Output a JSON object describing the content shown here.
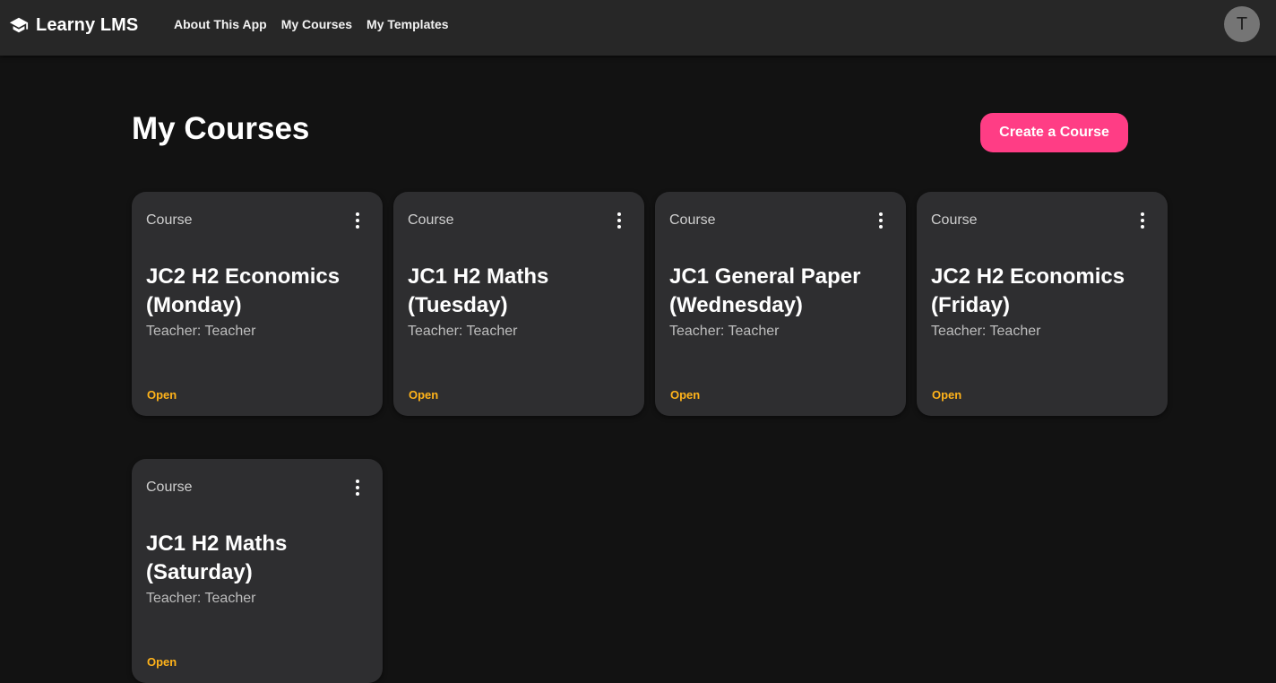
{
  "app": {
    "title": "Learny LMS",
    "icon": "graduation-cap-icon"
  },
  "nav": {
    "items": [
      {
        "label": "About This App"
      },
      {
        "label": "My Courses"
      },
      {
        "label": "My Templates"
      }
    ]
  },
  "user": {
    "avatar_initial": "T"
  },
  "main": {
    "title": "My Courses",
    "create_button": "Create a Course"
  },
  "courses": [
    {
      "kind": "Course",
      "title": "JC2 H2 Economics (Monday)",
      "teacher": "Teacher: Teacher",
      "action": "Open"
    },
    {
      "kind": "Course",
      "title": "JC1 H2 Maths (Tuesday)",
      "teacher": "Teacher: Teacher",
      "action": "Open"
    },
    {
      "kind": "Course",
      "title": "JC1 General Paper (Wednesday)",
      "teacher": "Teacher: Teacher",
      "action": "Open"
    },
    {
      "kind": "Course",
      "title": "JC2 H2 Economics (Friday)",
      "teacher": "Teacher: Teacher",
      "action": "Open"
    },
    {
      "kind": "Course",
      "title": "JC1 H2 Maths (Saturday)",
      "teacher": "Teacher: Teacher",
      "action": "Open"
    }
  ],
  "colors": {
    "background": "#121212",
    "topbar": "#272727",
    "card": "#2e2e30",
    "accent": "#ff3d85",
    "open_link": "#ffb31a"
  }
}
